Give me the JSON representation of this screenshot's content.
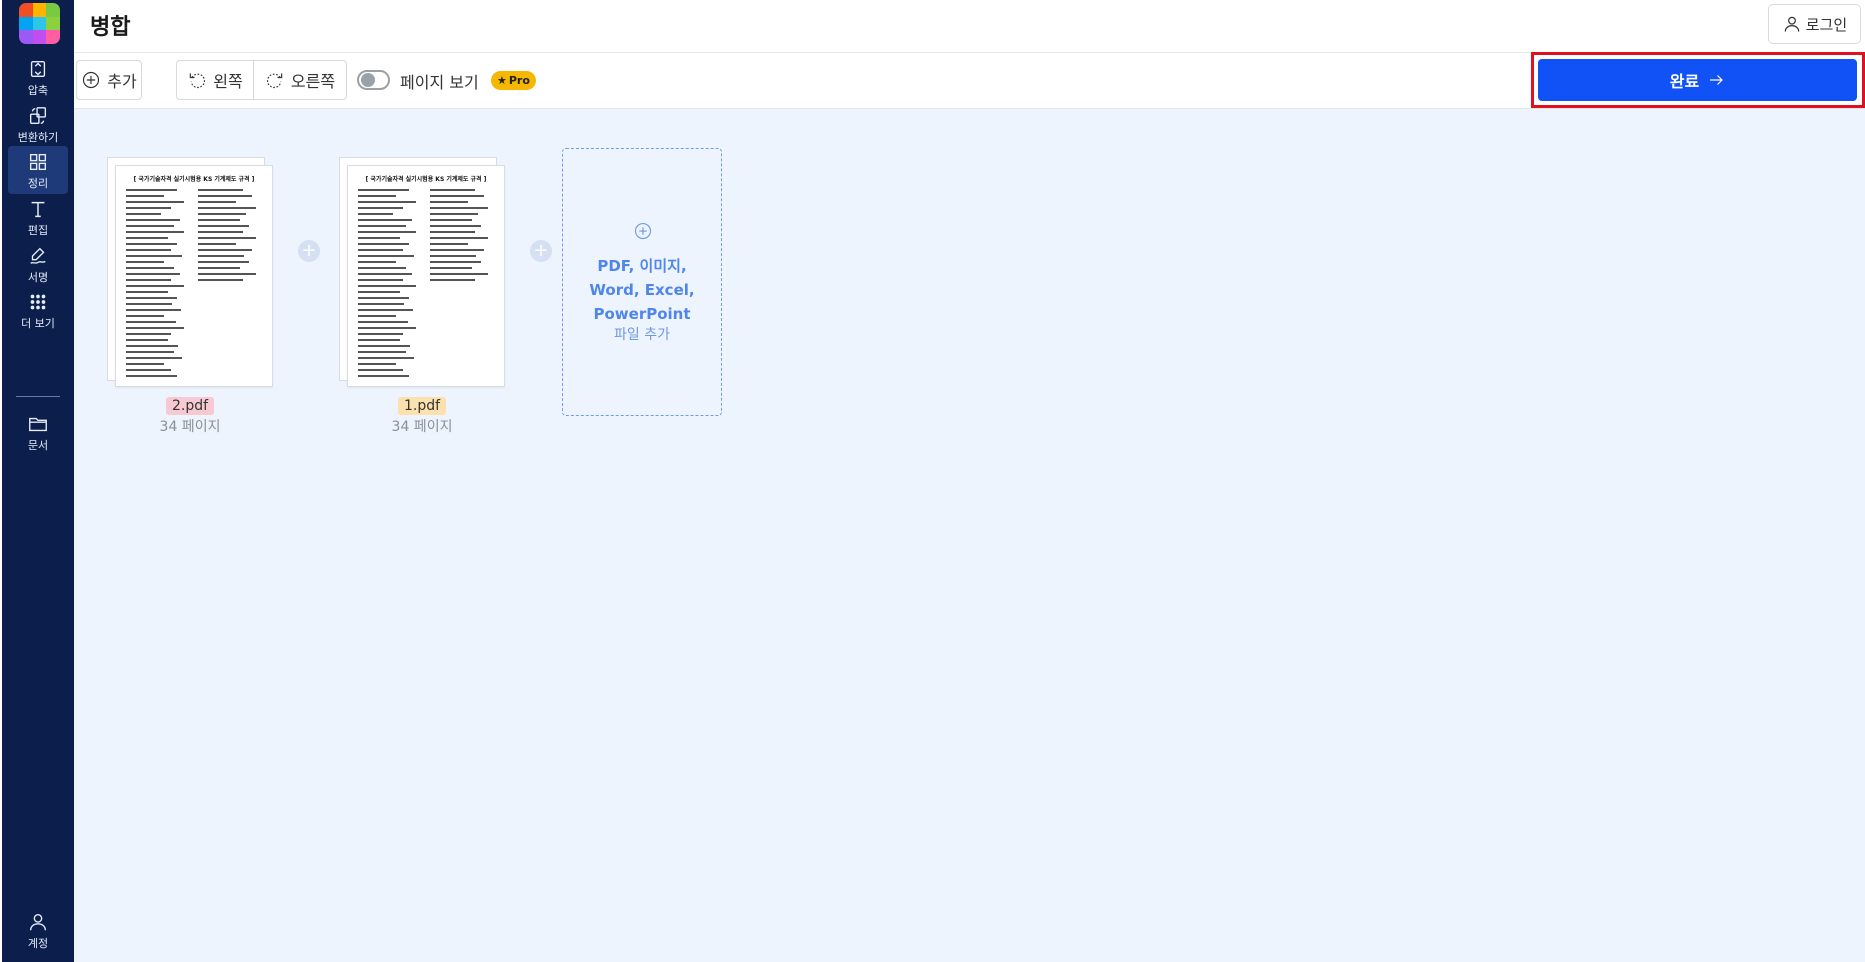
{
  "app": {
    "logo_colors": [
      "#f04e23",
      "#ffb400",
      "#7ac943",
      "#00a4ef",
      "#2dc5e8",
      "#8bd13d",
      "#9b59f5",
      "#c04ef0",
      "#ff5fa2"
    ]
  },
  "sidebar": {
    "items": [
      {
        "label": "압축",
        "icon": "compress-icon"
      },
      {
        "label": "변환하기",
        "icon": "convert-icon"
      },
      {
        "label": "정리",
        "icon": "grid-icon",
        "active": true
      },
      {
        "label": "편집",
        "icon": "text-edit-icon"
      },
      {
        "label": "서명",
        "icon": "signature-icon"
      },
      {
        "label": "더 보기",
        "icon": "more-apps-icon"
      },
      {
        "label": "문서",
        "icon": "folder-icon"
      }
    ],
    "account_label": "계정"
  },
  "header": {
    "title": "병합",
    "login_label": "로그인"
  },
  "toolbar": {
    "add_label": "추가",
    "rotate_left_label": "왼쪽",
    "rotate_right_label": "오른쪽",
    "page_view_label": "페이지 보기",
    "page_view_enabled": false,
    "pro_badge": "Pro",
    "done_label": "완료"
  },
  "files": [
    {
      "name": "2.pdf",
      "pages": "34 페이지",
      "tag_color": "#f7c9d2",
      "doc_title": "[ 국가기술자격 실기시험용 KS 기계제도 규격 ]"
    },
    {
      "name": "1.pdf",
      "pages": "34 페이지",
      "tag_color": "#fbe1ad",
      "doc_title": "[ 국가기술자격 실기시험용 KS 기계제도 규격 ]"
    }
  ],
  "add_zone": {
    "types_line1": "PDF, 이미지,",
    "types_line2": "Word, Excel,",
    "types_line3": "PowerPoint",
    "label": "파일 추가"
  },
  "colors": {
    "sidebar_bg": "#0c1e4c",
    "primary": "#1052f5",
    "highlight": "#e01020",
    "workspace_bg": "#eef4fd"
  }
}
